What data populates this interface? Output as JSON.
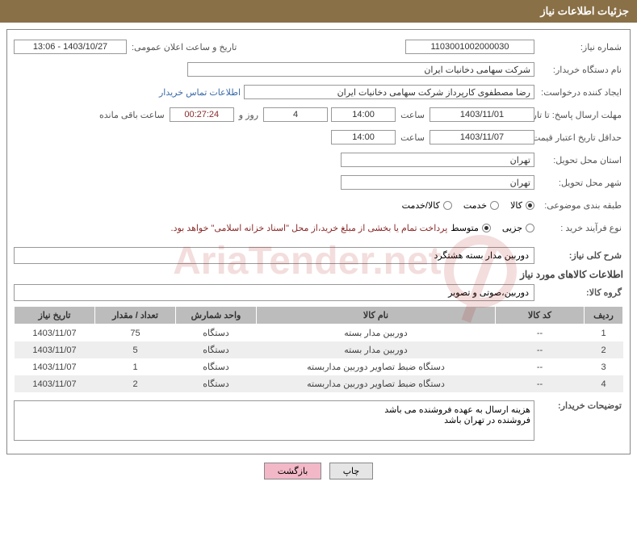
{
  "header": {
    "title": "جزئیات اطلاعات نیاز"
  },
  "fields": {
    "need_number_label": "شماره نیاز:",
    "need_number": "1103001002000030",
    "announce_label": "تاریخ و ساعت اعلان عمومی:",
    "announce": "1403/10/27 - 13:06",
    "buyer_label": "نام دستگاه خریدار:",
    "buyer": "شرکت سهامی دخانیات ایران",
    "requester_label": "ایجاد کننده درخواست:",
    "requester": "رضا مصطفوی کارپرداز شرکت سهامی دخانیات ایران",
    "contact_link": "اطلاعات تماس خریدار",
    "deadline_label": "مهلت ارسال پاسخ: تا تاریخ:",
    "deadline_date": "1403/11/01",
    "time_label": "ساعت",
    "deadline_time": "14:00",
    "days": "4",
    "days_label": "روز و",
    "countdown": "00:27:24",
    "remaining_label": "ساعت باقی مانده",
    "validity_label": "حداقل تاریخ اعتبار قیمت: تا تاریخ:",
    "validity_date": "1403/11/07",
    "validity_time": "14:00",
    "province_label": "استان محل تحویل:",
    "province": "تهران",
    "city_label": "شهر محل تحویل:",
    "city": "تهران",
    "category_label": "طبقه بندی موضوعی:",
    "cat_goods": "کالا",
    "cat_service": "خدمت",
    "cat_both": "کالا/خدمت",
    "process_label": "نوع فرآیند خرید :",
    "proc_minor": "جزیی",
    "proc_medium": "متوسط",
    "process_note": "پرداخت تمام یا بخشی از مبلغ خرید،از محل \"اسناد خزانه اسلامی\" خواهد بود.",
    "desc_label": "شرح کلی نیاز:",
    "desc": "دوربین مدار بسته هشتگرد",
    "items_title": "اطلاعات کالاهای مورد نیاز",
    "group_label": "گروه کالا:",
    "group": "دوربین،صوتی و تصویر",
    "buyer_notes_label": "توضیحات خریدار:",
    "buyer_notes": "هزینه ارسال به عهده فروشنده می باشد\nفروشنده در تهران باشد"
  },
  "table": {
    "headers": [
      "ردیف",
      "کد کالا",
      "نام کالا",
      "واحد شمارش",
      "تعداد / مقدار",
      "تاریخ نیاز"
    ],
    "rows": [
      [
        "1",
        "--",
        "دوربین مدار بسته",
        "دستگاه",
        "75",
        "1403/11/07"
      ],
      [
        "2",
        "--",
        "دوربین مدار بسته",
        "دستگاه",
        "5",
        "1403/11/07"
      ],
      [
        "3",
        "--",
        "دستگاه ضبط تصاویر دوربین مداربسته",
        "دستگاه",
        "1",
        "1403/11/07"
      ],
      [
        "4",
        "--",
        "دستگاه ضبط تصاویر دوربین مداربسته",
        "دستگاه",
        "2",
        "1403/11/07"
      ]
    ]
  },
  "buttons": {
    "print": "چاپ",
    "back": "بازگشت"
  },
  "watermark": "AriaTender.net"
}
